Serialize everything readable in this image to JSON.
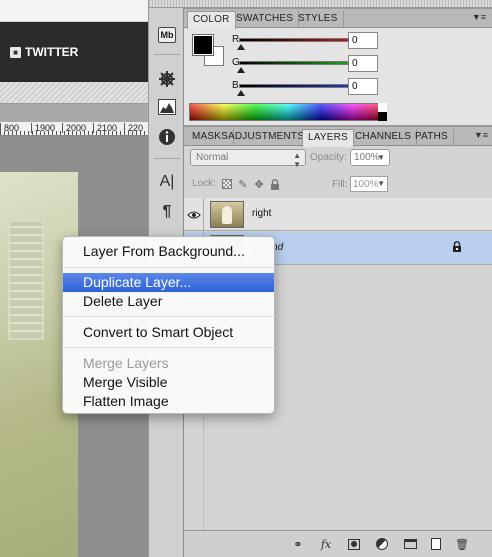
{
  "browser": {
    "twitter_label": "TWITTER"
  },
  "ruler": {
    "labels": [
      "800",
      "1900",
      "2000",
      "2100",
      "220"
    ]
  },
  "dock": {
    "icons": [
      "mini-bridge-icon",
      "navigator-wheel-icon",
      "histogram-icon",
      "info-icon",
      "character-icon",
      "paragraph-icon"
    ],
    "mini_bridge_label": "Mb"
  },
  "color_panel": {
    "tabs": [
      "COLOR",
      "SWATCHES",
      "STYLES"
    ],
    "active_tab": "COLOR",
    "channels": [
      {
        "label": "R",
        "value": "0",
        "color": "#e02020"
      },
      {
        "label": "G",
        "value": "0",
        "color": "#22c522"
      },
      {
        "label": "B",
        "value": "0",
        "color": "#2a3fe0"
      }
    ],
    "foreground": "#000000",
    "background": "#ffffff"
  },
  "layers_panel": {
    "tabs": [
      "MASKS",
      "ADJUSTMENTS",
      "LAYERS",
      "CHANNELS",
      "PATHS"
    ],
    "active_tab": "LAYERS",
    "blend_mode": "Normal",
    "opacity_label": "Opacity:",
    "opacity_value": "100%",
    "lock_label": "Lock:",
    "fill_label": "Fill:",
    "fill_value": "100%",
    "layers": [
      {
        "name": "right",
        "visible": true,
        "selected": false
      },
      {
        "name": "ground",
        "visible": true,
        "selected": true,
        "locked": true
      }
    ],
    "footer_icons": [
      "link-layers-icon",
      "fx-icon",
      "add-mask-icon",
      "adjustment-layer-icon",
      "new-group-icon",
      "new-layer-icon",
      "trash-icon"
    ],
    "fx_label": "fx"
  },
  "context_menu": {
    "items": [
      {
        "label": "Layer From Background...",
        "state": "normal"
      },
      {
        "label": "Duplicate Layer...",
        "state": "highlighted"
      },
      {
        "label": "Delete Layer",
        "state": "normal"
      },
      {
        "label": "Convert to Smart Object",
        "state": "normal"
      },
      {
        "label": "Merge Layers",
        "state": "disabled"
      },
      {
        "label": "Merge Visible",
        "state": "normal"
      },
      {
        "label": "Flatten Image",
        "state": "normal"
      }
    ],
    "highlight_color": "#3a6ee0"
  }
}
